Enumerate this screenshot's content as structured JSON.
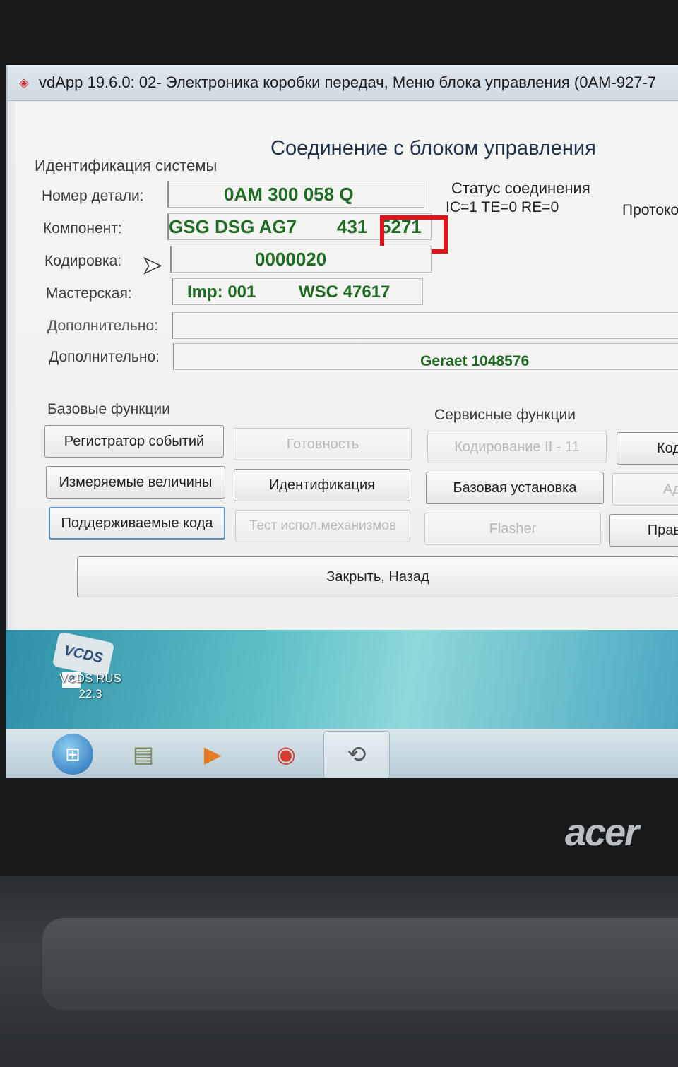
{
  "window": {
    "title": "vdApp 19.6.0: 02- Электроника коробки передач,  Меню блока управления (0AM-927-7"
  },
  "header": {
    "heading": "Соединение с блоком управления",
    "ident_section": "Идентификация системы",
    "status_label": "Статус соединения",
    "status_values": "IC=1  TE=0   RE=0",
    "protocol_label": "Протоко"
  },
  "fields": {
    "part_label": "Номер детали:",
    "part_value": "0AM 300 058 Q",
    "component_label": "Компонент:",
    "component_value_a": "GSG DSG AG7",
    "component_value_b": "431",
    "component_value_c": "5271",
    "coding_label": "Кодировка:",
    "coding_value": "0000020",
    "workshop_label": "Мастерская:",
    "workshop_imp": "Imp: 001",
    "workshop_wsc": "WSC 47617",
    "extra1_label": "Дополнительно:",
    "extra2_label": "Дополнительно:",
    "extra2_value": "Geraet 1048576"
  },
  "basic": {
    "title": "Базовые функции",
    "event_recorder": "Регистратор событий",
    "readiness": "Готовность",
    "measured_values": "Измеряемые величины",
    "identification": "Идентификация",
    "supported_codes": "Поддерживаемые кода",
    "actuator_test": "Тест испол.механизмов"
  },
  "service": {
    "title": "Сервисные функции",
    "coding2": "Кодирование II - 11",
    "coding_cut": "Код",
    "basic_settings": "Базовая установка",
    "adapt_cut": "Ад",
    "flasher": "Flasher",
    "rights_cut": "Прав"
  },
  "close_back": "Закрыть, Назад",
  "desktop": {
    "logo_text": "VCDS",
    "icon_label_1": "VCDS RUS",
    "icon_label_2": "22.3"
  },
  "laptop_brand": "acer"
}
